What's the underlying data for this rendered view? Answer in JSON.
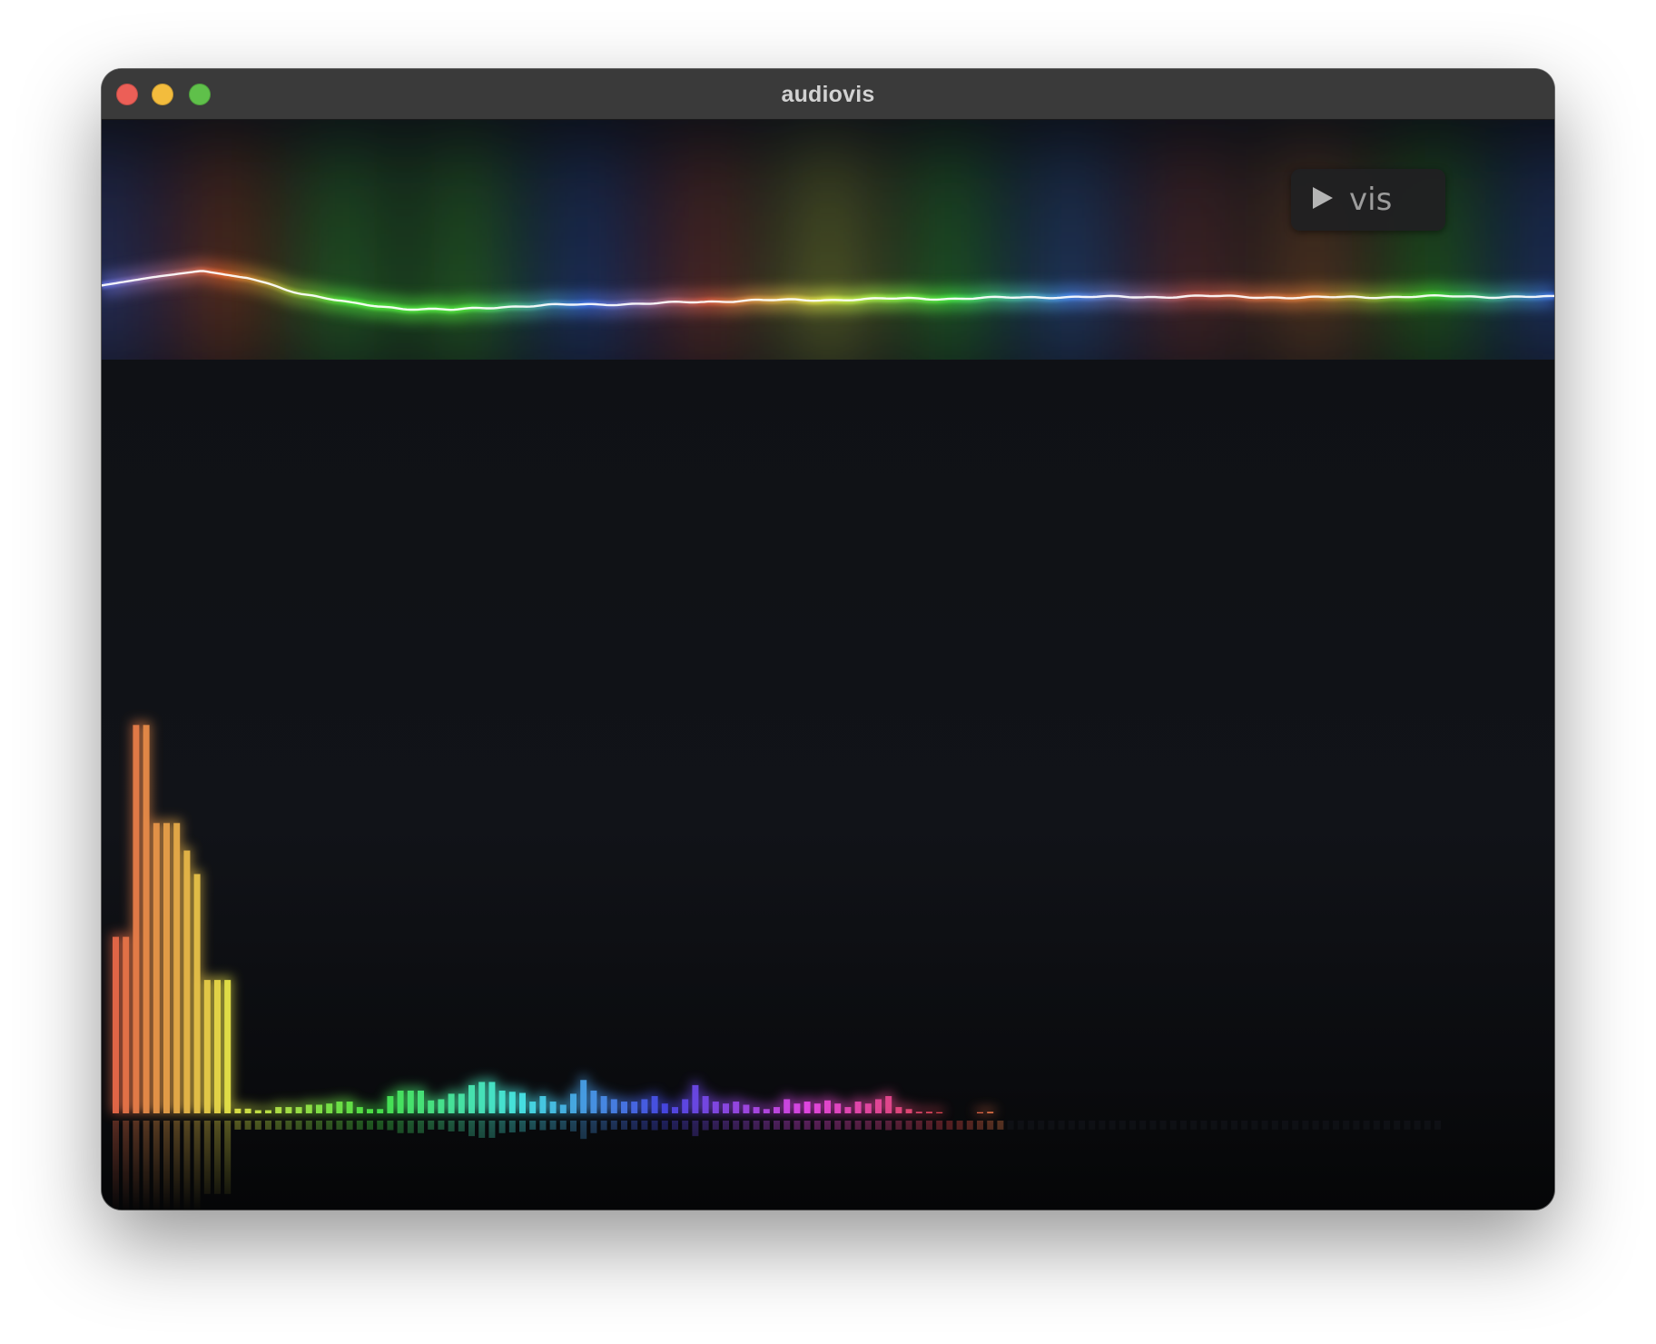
{
  "window": {
    "title": "audiovis",
    "controls": [
      {
        "name": "close-button",
        "color": "#ec5f57"
      },
      {
        "name": "minimize-button",
        "color": "#f3bc3d"
      },
      {
        "name": "zoom-button",
        "color": "#5fc04a"
      }
    ]
  },
  "vis_button": {
    "label": "vis",
    "icon": "play-icon"
  },
  "waveform": {
    "band_colors": [
      "#5a6bd8",
      "#e0642e",
      "#4fe03c",
      "#4fe03c",
      "#3f6fe0",
      "#d05b42",
      "#d8e84a",
      "#44e040",
      "#4a86e8",
      "#b0504a",
      "#d27a38",
      "#40d030",
      "#3f6fe0"
    ],
    "wave_samples": [
      0.07,
      0.12,
      0.16,
      0.11,
      0.02,
      -0.04,
      -0.07,
      -0.08,
      -0.06,
      -0.05,
      -0.045,
      -0.04,
      -0.03,
      -0.02,
      -0.02,
      -0.015,
      -0.01,
      -0.01,
      -0.005,
      0.0,
      0.0,
      0.0,
      0.005,
      0.0,
      -0.005,
      0.0,
      0.0,
      0.005,
      0.0,
      0.0
    ]
  },
  "chart_data": {
    "type": "bar",
    "bin_count": 131,
    "values": [
      0.45,
      0.45,
      0.99,
      0.99,
      0.74,
      0.74,
      0.74,
      0.67,
      0.61,
      0.34,
      0.34,
      0.34,
      0.012,
      0.012,
      0.008,
      0.008,
      0.016,
      0.016,
      0.016,
      0.022,
      0.022,
      0.025,
      0.03,
      0.03,
      0.016,
      0.011,
      0.011,
      0.044,
      0.058,
      0.058,
      0.058,
      0.033,
      0.036,
      0.05,
      0.05,
      0.072,
      0.08,
      0.08,
      0.058,
      0.055,
      0.052,
      0.03,
      0.044,
      0.03,
      0.022,
      0.05,
      0.085,
      0.058,
      0.044,
      0.036,
      0.03,
      0.03,
      0.036,
      0.044,
      0.025,
      0.016,
      0.036,
      0.072,
      0.044,
      0.03,
      0.025,
      0.03,
      0.022,
      0.016,
      0.011,
      0.016,
      0.036,
      0.025,
      0.03,
      0.025,
      0.033,
      0.025,
      0.016,
      0.03,
      0.025,
      0.036,
      0.044,
      0.016,
      0.011,
      0.004,
      0.004,
      0.003,
      0.0,
      0.0,
      0.0,
      0.003,
      0.004,
      0.0
    ],
    "hue_start": 12,
    "hue_end": 380,
    "reflection": true
  }
}
